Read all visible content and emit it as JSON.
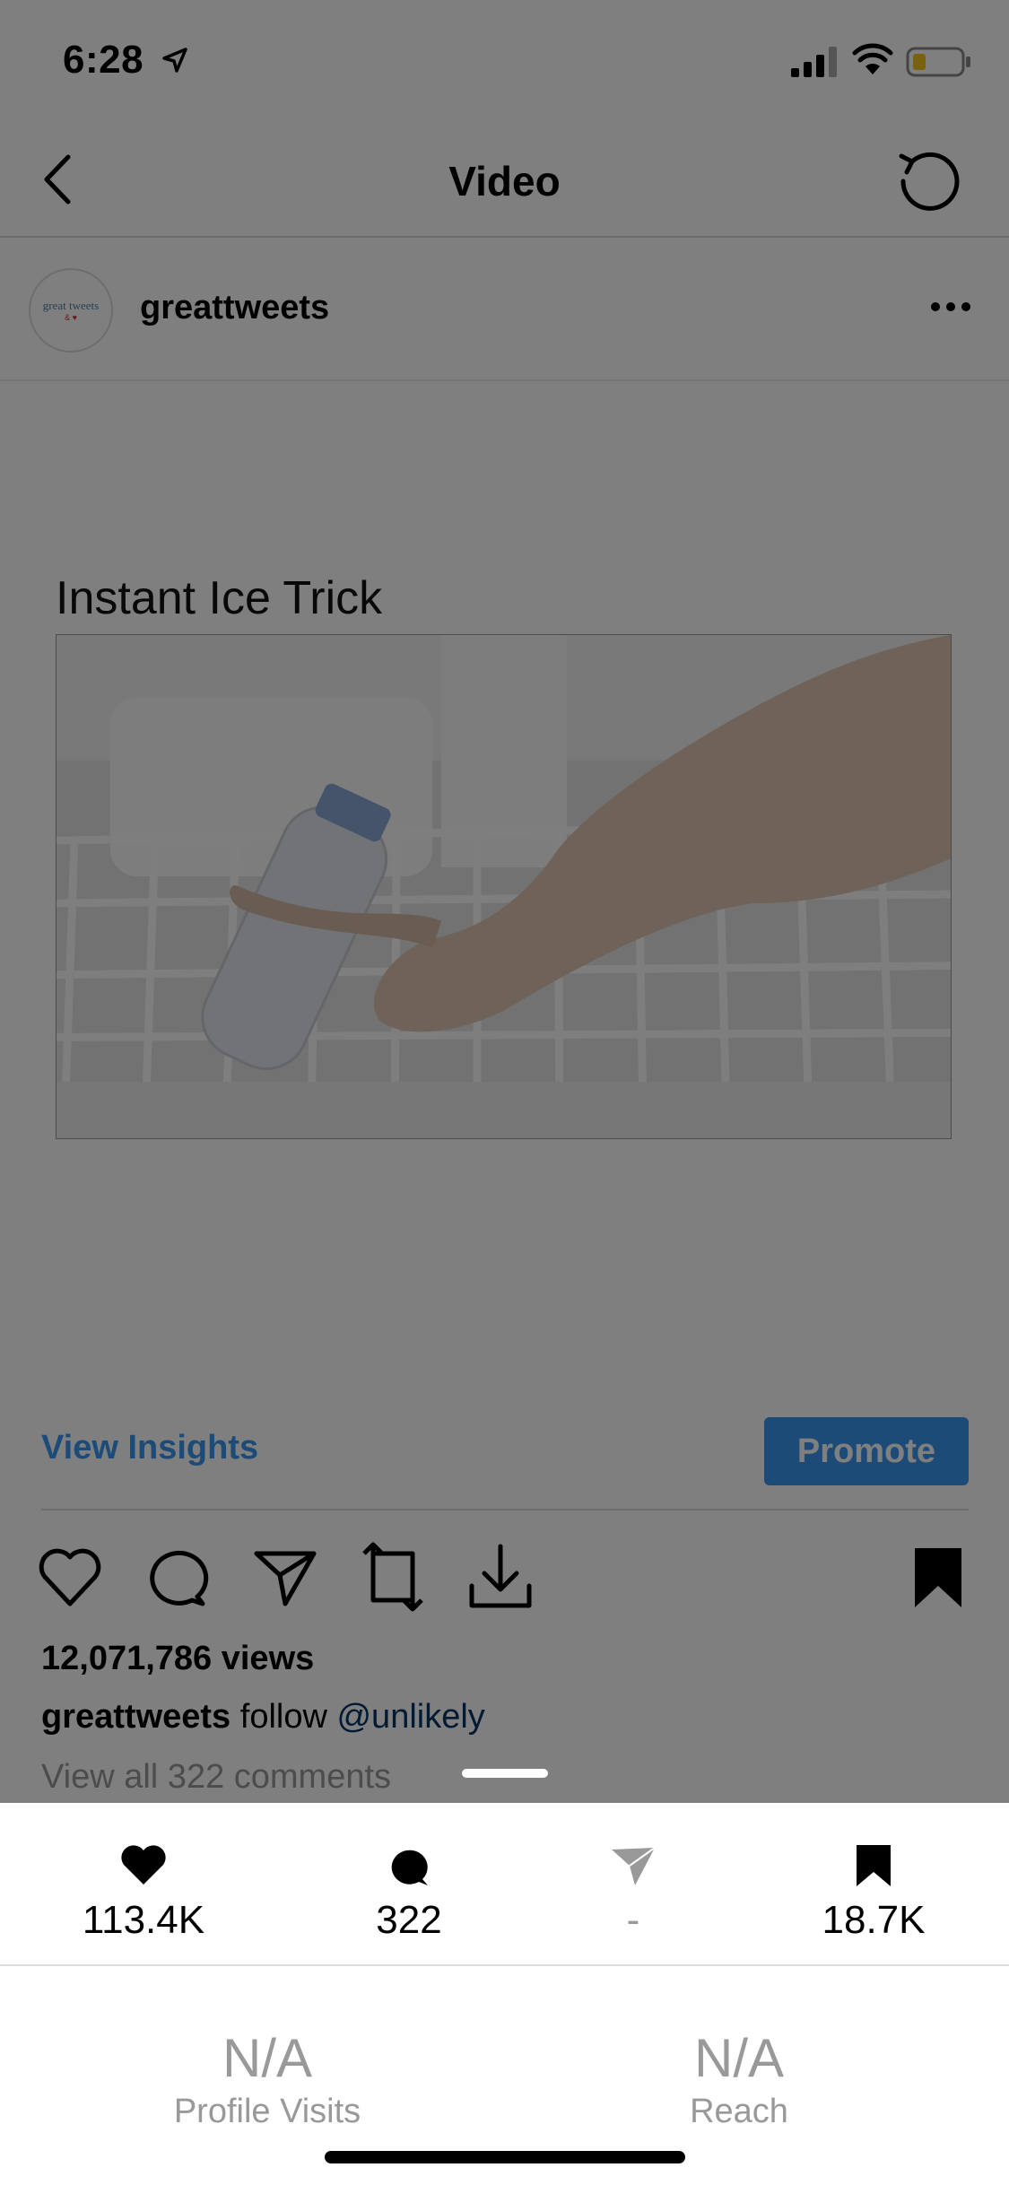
{
  "status_bar": {
    "time": "6:28"
  },
  "nav": {
    "title": "Video"
  },
  "post": {
    "username": "greattweets",
    "avatar_text": "great tweets",
    "avatar_sub": "& ♥",
    "video_caption": "Instant Ice Trick",
    "views": "12,071,786 views",
    "caption_user": "greattweets",
    "caption_text": "follow",
    "caption_mention": "@unlikely",
    "comments_link": "View all 322 comments"
  },
  "actions": {
    "view_insights": "View Insights",
    "promote": "Promote",
    "icons": [
      "heart-icon",
      "comment-icon",
      "share-icon",
      "repost-icon",
      "download-icon",
      "bookmark-icon"
    ]
  },
  "insights": {
    "stats": [
      {
        "icon": "heart-icon",
        "value": "113.4K"
      },
      {
        "icon": "comment-icon",
        "value": "322"
      },
      {
        "icon": "share-icon",
        "value": "-"
      },
      {
        "icon": "bookmark-icon",
        "value": "18.7K"
      }
    ],
    "metrics": [
      {
        "value": "N/A",
        "label": "Profile Visits"
      },
      {
        "value": "N/A",
        "label": "Reach"
      }
    ]
  },
  "colors": {
    "accent": "#3897f0",
    "mention": "#003569",
    "muted": "#999999"
  }
}
